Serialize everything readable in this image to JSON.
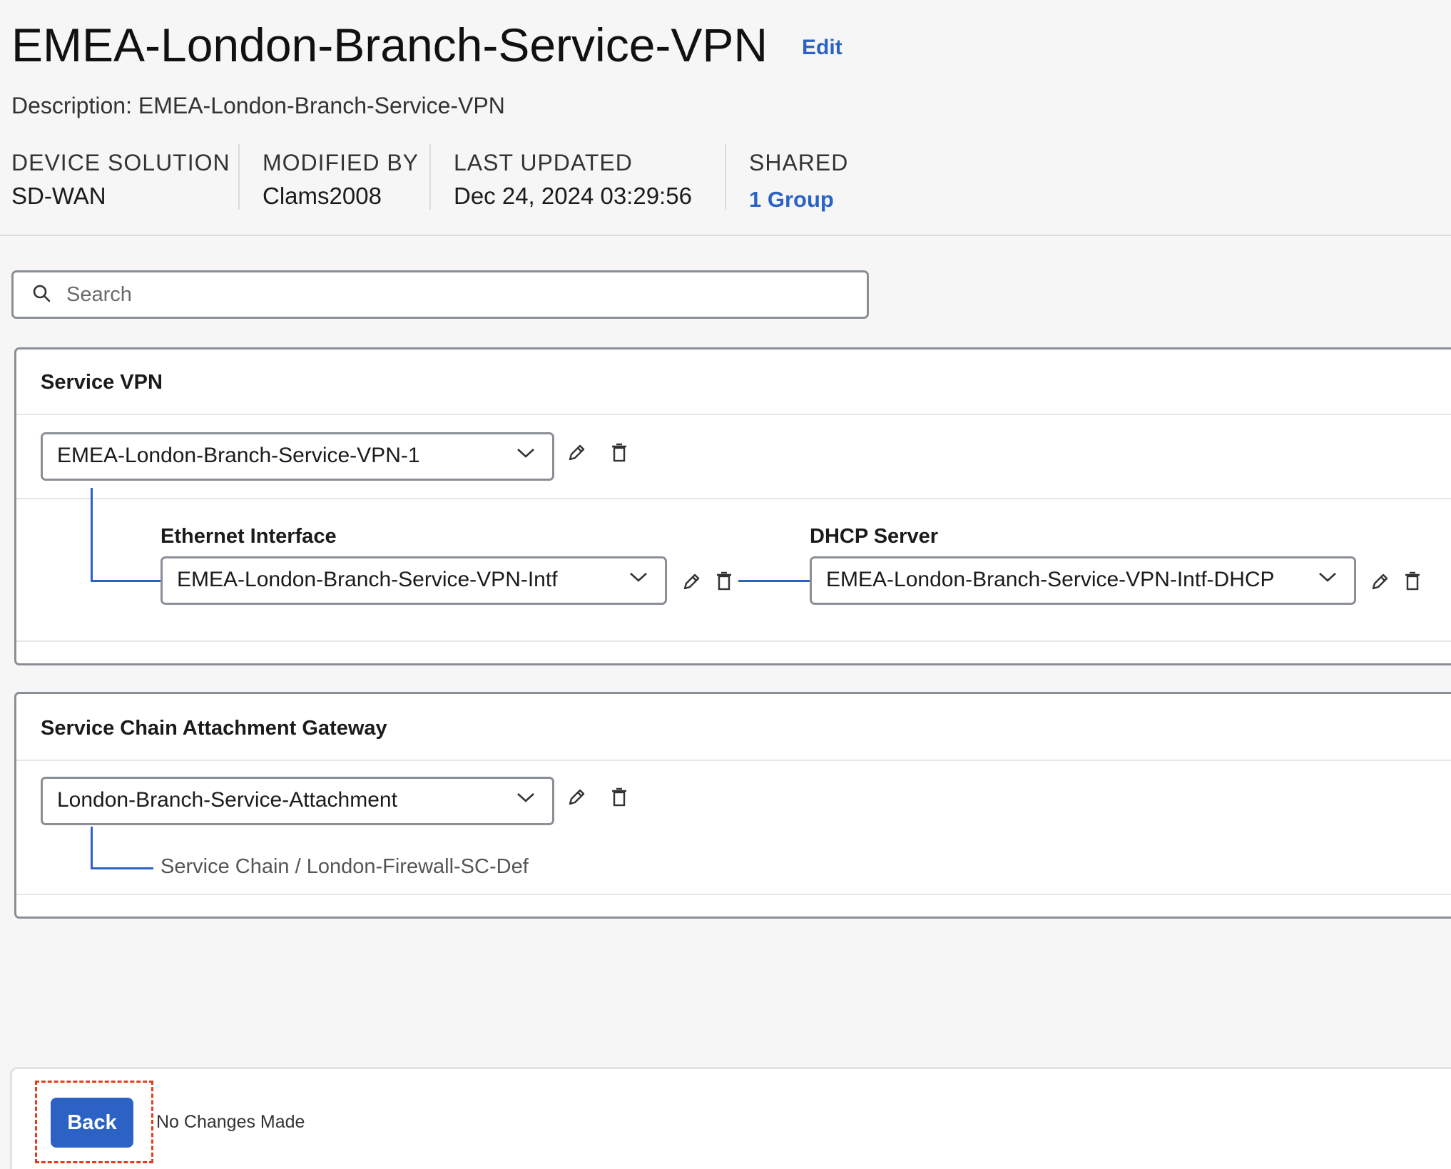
{
  "header": {
    "title": "EMEA-London-Branch-Service-VPN",
    "edit_label": "Edit",
    "description": "Description: EMEA-London-Branch-Service-VPN",
    "meta": {
      "device_solution_label": "DEVICE SOLUTION",
      "device_solution_value": "SD-WAN",
      "modified_by_label": "MODIFIED BY",
      "modified_by_value": "Clams2008",
      "last_updated_label": "LAST UPDATED",
      "last_updated_value": "Dec 24, 2024 03:29:56",
      "shared_label": "SHARED",
      "shared_value": "1 Group"
    }
  },
  "search": {
    "placeholder": "Search"
  },
  "service_vpn": {
    "title": "Service VPN",
    "selected": "EMEA-London-Branch-Service-VPN-1",
    "ethernet_label": "Ethernet Interface",
    "ethernet_selected": "EMEA-London-Branch-Service-VPN-Intf",
    "dhcp_label": "DHCP Server",
    "dhcp_selected": "EMEA-London-Branch-Service-VPN-Intf-DHCP"
  },
  "service_chain": {
    "title": "Service Chain Attachment Gateway",
    "selected": "London-Branch-Service-Attachment",
    "child_text": "Service Chain / London-Firewall-SC-Def"
  },
  "footer": {
    "back_label": "Back",
    "status_text": "No Changes Made"
  },
  "colors": {
    "accent": "#2b62c4",
    "highlight": "#e63b1e",
    "border": "#8a8f96"
  },
  "icons": [
    "search-icon",
    "chevron-down-icon",
    "pencil-icon",
    "trash-icon"
  ]
}
